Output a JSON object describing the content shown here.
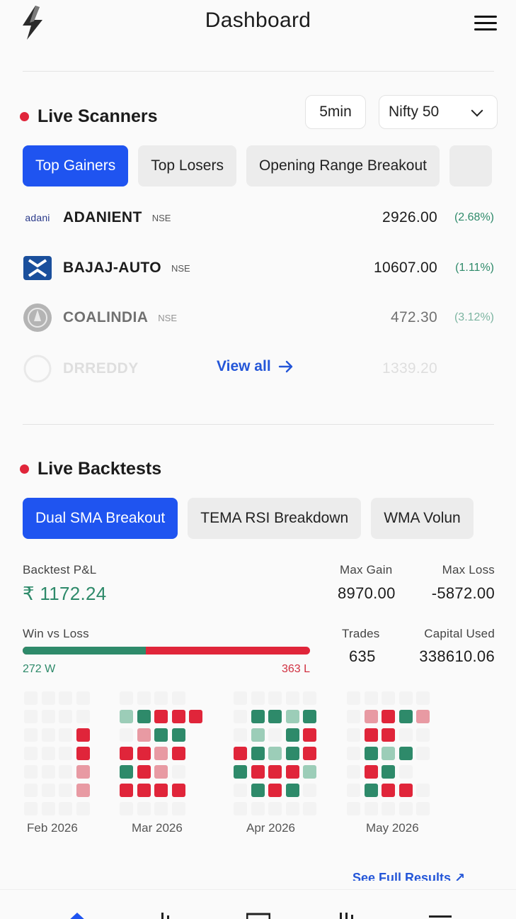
{
  "header": {
    "title": "Dashboard",
    "logo_icon": "lightning-bolt-logo",
    "menu_icon": "hamburger-menu-icon"
  },
  "scanners": {
    "title": "Live Scanners",
    "interval": "5min",
    "index": "Nifty 50",
    "tabs": [
      "Top Gainers",
      "Top Losers",
      "Opening Range Breakout",
      ""
    ],
    "active_tab": 0,
    "rows": [
      {
        "logo": "adani",
        "symbol": "ADANIENT",
        "exchange": "NSE",
        "price": "2926.00",
        "change": "(2.68%)"
      },
      {
        "logo": "bajaj-logo-icon",
        "symbol": "BAJAJ-AUTO",
        "exchange": "NSE",
        "price": "10607.00",
        "change": "(1.11%)"
      },
      {
        "logo": "coalindia-logo-icon",
        "symbol": "COALINDIA",
        "exchange": "NSE",
        "price": "472.30",
        "change": "(3.12%)"
      },
      {
        "logo": "drreddy-logo-icon",
        "symbol": "DRREDDY",
        "exchange": "",
        "price": "1339.20",
        "change": ""
      }
    ],
    "view_all": "View all"
  },
  "backtests": {
    "title": "Live Backtests",
    "tabs": [
      "Dual SMA Breakout",
      "TEMA RSI Breakdown",
      "WMA Volun"
    ],
    "active_tab": 0,
    "pnl_label": "Backtest P&L",
    "pnl_value": "₹ 1172.24",
    "max_gain_label": "Max Gain",
    "max_gain": "8970.00",
    "max_loss_label": "Max Loss",
    "max_loss": "-5872.00",
    "winloss_label": "Win vs Loss",
    "wins": 272,
    "losses": 363,
    "wins_text": "272 W",
    "losses_text": "363 L",
    "trades_label": "Trades",
    "trades": "635",
    "capital_label": "Capital Used",
    "capital": "338610.06",
    "months": [
      "Feb 2026",
      "Mar 2026",
      "Apr 2026",
      "May 2026"
    ],
    "full_results": "See Full Results"
  },
  "colors": {
    "accent": "#1f54f0",
    "gain": "#2e8a6a",
    "loss": "#e0253a",
    "loss_light": "#e89aa3",
    "gain_light": "#9ccdb8",
    "empty": "#ececec"
  }
}
